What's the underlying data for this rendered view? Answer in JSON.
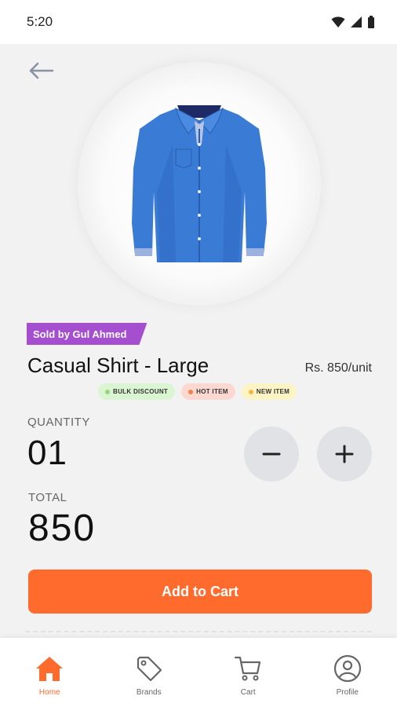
{
  "status_bar": {
    "time": "5:20"
  },
  "product": {
    "seller_tag": "Sold by Gul Ahmed",
    "title": "Casual Shirt - Large",
    "price": "Rs. 850/unit",
    "image_icon": "shirt-image",
    "badges": [
      {
        "label": "BULK DISCOUNT",
        "color": "#9ad37f"
      },
      {
        "label": "HOT ITEM",
        "color": "#f3814f"
      },
      {
        "label": "NEW ITEM",
        "color": "#f6b73c"
      }
    ]
  },
  "quantity": {
    "label": "QUANTITY",
    "value": "01"
  },
  "total": {
    "label": "TOTAL",
    "value": "850"
  },
  "cta": {
    "label": "Add to Cart"
  },
  "bottom_nav": {
    "items": [
      {
        "label": "Home",
        "icon": "home-icon",
        "active": true
      },
      {
        "label": "Brands",
        "icon": "tag-icon",
        "active": false
      },
      {
        "label": "Cart",
        "icon": "cart-icon",
        "active": false
      },
      {
        "label": "Profile",
        "icon": "profile-icon",
        "active": false
      }
    ]
  },
  "colors": {
    "accent": "#ff6b2c",
    "seller_tag": "#a54fd0",
    "background": "#f2f2f2"
  }
}
